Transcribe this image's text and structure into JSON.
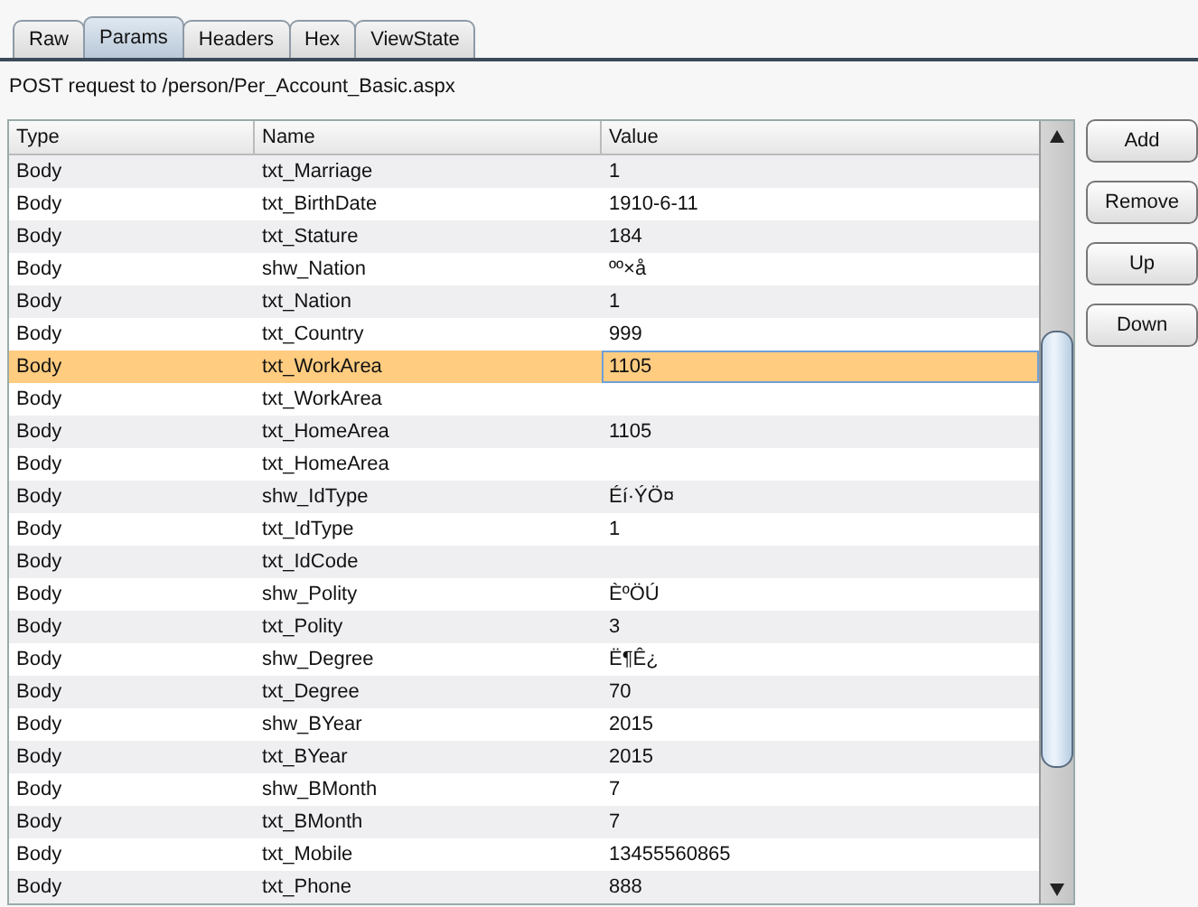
{
  "tabs": [
    {
      "label": "Raw",
      "selected": false
    },
    {
      "label": "Params",
      "selected": true
    },
    {
      "label": "Headers",
      "selected": false
    },
    {
      "label": "Hex",
      "selected": false
    },
    {
      "label": "ViewState",
      "selected": false
    }
  ],
  "request_line": "POST request to /person/Per_Account_Basic.aspx",
  "table": {
    "columns": [
      "Type",
      "Name",
      "Value"
    ],
    "rows": [
      {
        "type": "Body",
        "name": "txt_Marriage",
        "value": "1",
        "selected": false
      },
      {
        "type": "Body",
        "name": "txt_BirthDate",
        "value": "1910-6-11",
        "selected": false
      },
      {
        "type": "Body",
        "name": "txt_Stature",
        "value": "184",
        "selected": false
      },
      {
        "type": "Body",
        "name": "shw_Nation",
        "value": "ºº×å",
        "selected": false
      },
      {
        "type": "Body",
        "name": "txt_Nation",
        "value": "1",
        "selected": false
      },
      {
        "type": "Body",
        "name": "txt_Country",
        "value": "999",
        "selected": false
      },
      {
        "type": "Body",
        "name": "txt_WorkArea",
        "value": "1105",
        "selected": true
      },
      {
        "type": "Body",
        "name": "txt_WorkArea",
        "value": "",
        "selected": false
      },
      {
        "type": "Body",
        "name": "txt_HomeArea",
        "value": "1105",
        "selected": false
      },
      {
        "type": "Body",
        "name": "txt_HomeArea",
        "value": "",
        "selected": false
      },
      {
        "type": "Body",
        "name": "shw_IdType",
        "value": "Éí·ÝÖ¤",
        "selected": false
      },
      {
        "type": "Body",
        "name": "txt_IdType",
        "value": "1",
        "selected": false
      },
      {
        "type": "Body",
        "name": "txt_IdCode",
        "value": "",
        "selected": false
      },
      {
        "type": "Body",
        "name": "shw_Polity",
        "value": "ÈºÖÚ",
        "selected": false
      },
      {
        "type": "Body",
        "name": "txt_Polity",
        "value": "3",
        "selected": false
      },
      {
        "type": "Body",
        "name": "shw_Degree",
        "value": "Ë¶Ê¿",
        "selected": false
      },
      {
        "type": "Body",
        "name": "txt_Degree",
        "value": "70",
        "selected": false
      },
      {
        "type": "Body",
        "name": "shw_BYear",
        "value": "2015",
        "selected": false
      },
      {
        "type": "Body",
        "name": "txt_BYear",
        "value": "2015",
        "selected": false
      },
      {
        "type": "Body",
        "name": "shw_BMonth",
        "value": "7",
        "selected": false
      },
      {
        "type": "Body",
        "name": "txt_BMonth",
        "value": "7",
        "selected": false
      },
      {
        "type": "Body",
        "name": "txt_Mobile",
        "value": "13455560865",
        "selected": false
      },
      {
        "type": "Body",
        "name": "txt_Phone",
        "value": "888",
        "selected": false
      }
    ]
  },
  "buttons": [
    "Add",
    "Remove",
    "Up",
    "Down"
  ]
}
